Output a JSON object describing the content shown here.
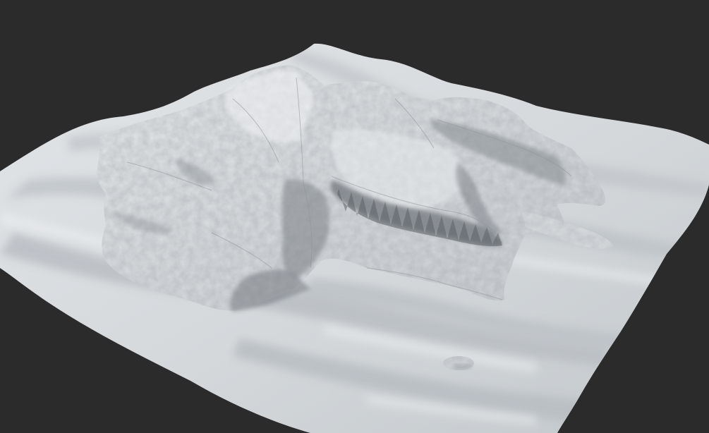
{
  "scene": {
    "background_color": "#2b2b2b",
    "subject": "terrain-render",
    "terrain_base_color": "#d8dcdf",
    "terrain_shadow_color": "#9aa0a6",
    "rock_detail_color": "#c8ccd0",
    "cliff_dark_color": "#6e7379"
  }
}
